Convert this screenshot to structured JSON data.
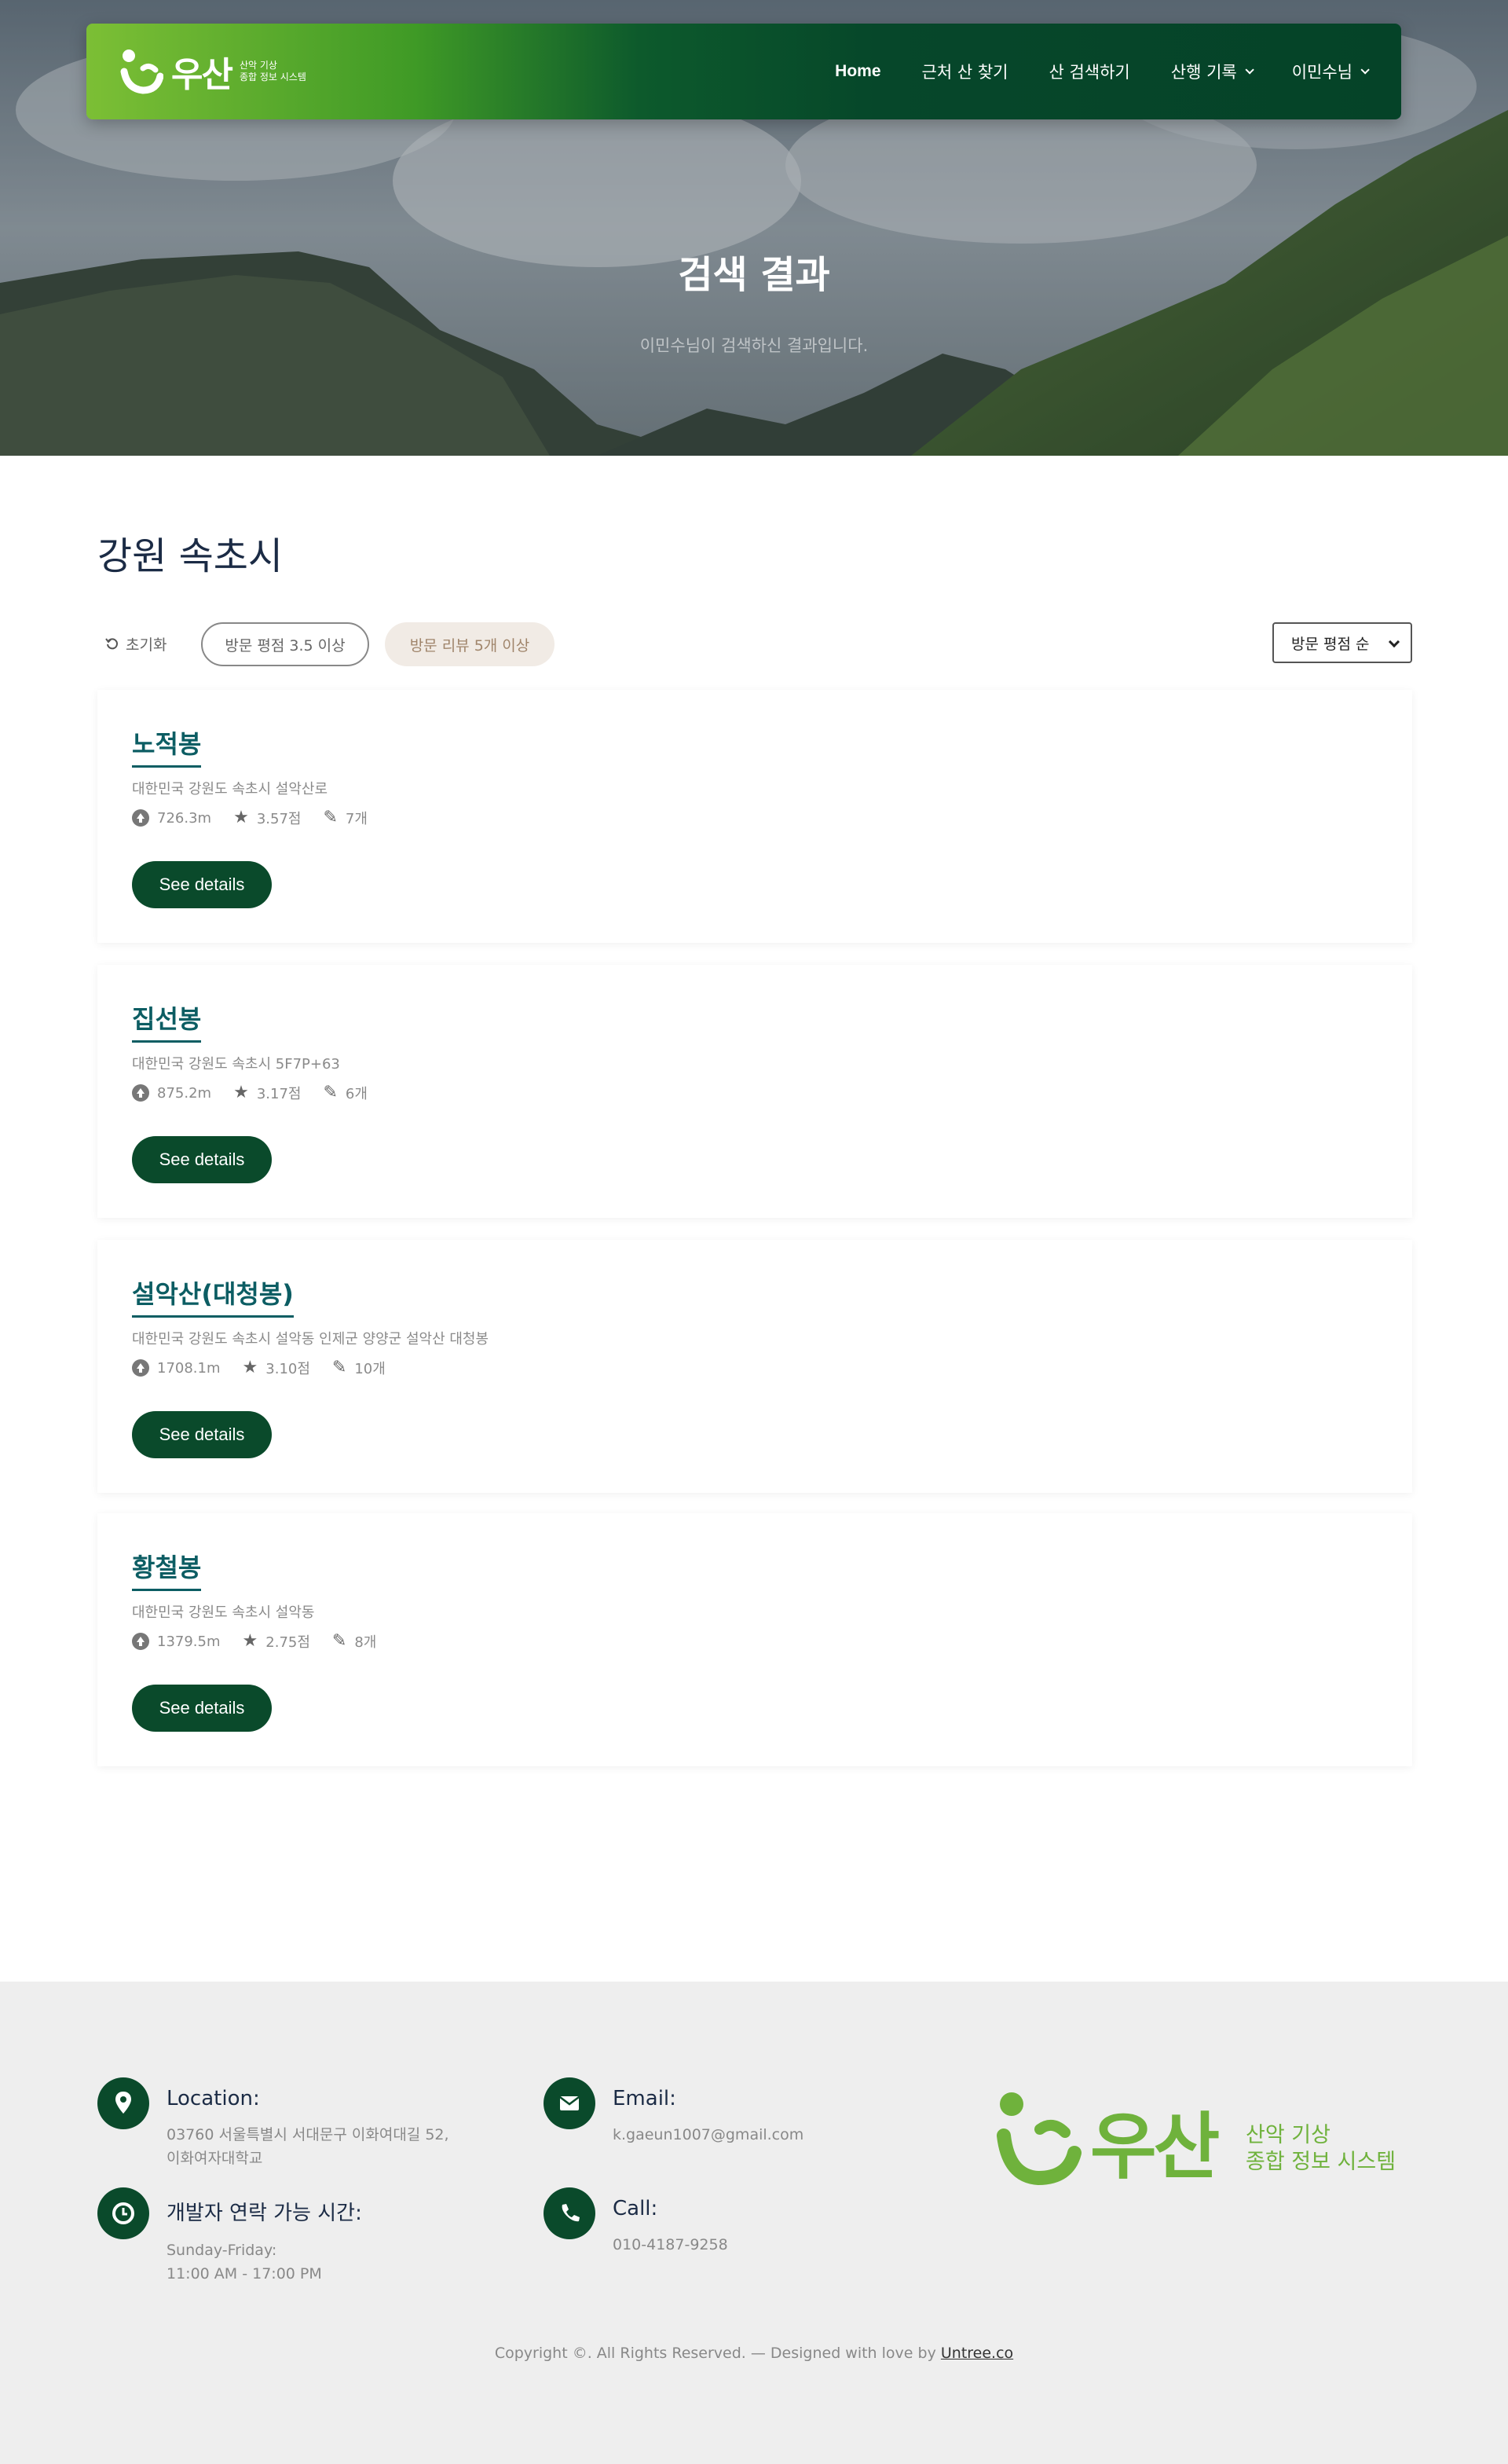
{
  "brand": {
    "name": "우산",
    "tagline_line1": "산악 기상",
    "tagline_line2": "종합 정보 시스템"
  },
  "nav": {
    "items": [
      {
        "label": "Home",
        "dropdown": false,
        "active": true
      },
      {
        "label": "근처 산 찾기",
        "dropdown": false
      },
      {
        "label": "산 검색하기",
        "dropdown": false
      },
      {
        "label": "산행 기록",
        "dropdown": true
      },
      {
        "label": "이민수님",
        "dropdown": true
      }
    ]
  },
  "hero": {
    "title": "검색 결과",
    "subtitle": "이민수님이 검색하신 결과입니다."
  },
  "region": "강원 속초시",
  "filters": {
    "reset_label": "초기화",
    "chip1": "방문 평점 3.5 이상",
    "chip2": "방문 리뷰 5개 이상",
    "sort_selected": "방문 평점 순"
  },
  "results": [
    {
      "name": "노적봉",
      "address": "대한민국 강원도 속초시 설악산로",
      "elevation": "726.3m",
      "rating": "3.57점",
      "reviews": "7개",
      "button": "See details"
    },
    {
      "name": "집선봉",
      "address": "대한민국 강원도 속초시 5F7P+63",
      "elevation": "875.2m",
      "rating": "3.17점",
      "reviews": "6개",
      "button": "See details"
    },
    {
      "name": "설악산(대청봉)",
      "address": "대한민국 강원도 속초시 설악동 인제군 양양군 설악산 대청봉",
      "elevation": "1708.1m",
      "rating": "3.10점",
      "reviews": "10개",
      "button": "See details"
    },
    {
      "name": "황철봉",
      "address": "대한민국 강원도 속초시 설악동",
      "elevation": "1379.5m",
      "rating": "2.75점",
      "reviews": "8개",
      "button": "See details"
    }
  ],
  "footer": {
    "location_label": "Location:",
    "location_line1": "03760 서울특별시 서대문구 이화여대길 52,",
    "location_line2": "이화여자대학교",
    "email_label": "Email:",
    "email": "k.gaeun1007@gmail.com",
    "hours_label": "개발자 연락 가능 시간:",
    "hours_line1": "Sunday-Friday:",
    "hours_line2": "11:00 AM - 17:00 PM",
    "call_label": "Call:",
    "phone": "010-4187-9258",
    "copyright": "Copyright ©. All Rights Reserved. — Designed with love by",
    "copyright_link": "Untree.co"
  },
  "colors": {
    "primary": "#0a4a2b",
    "accent_green": "#6fb23c",
    "title_teal": "#0c5d63",
    "chip_fill": "#f1ebe5"
  }
}
